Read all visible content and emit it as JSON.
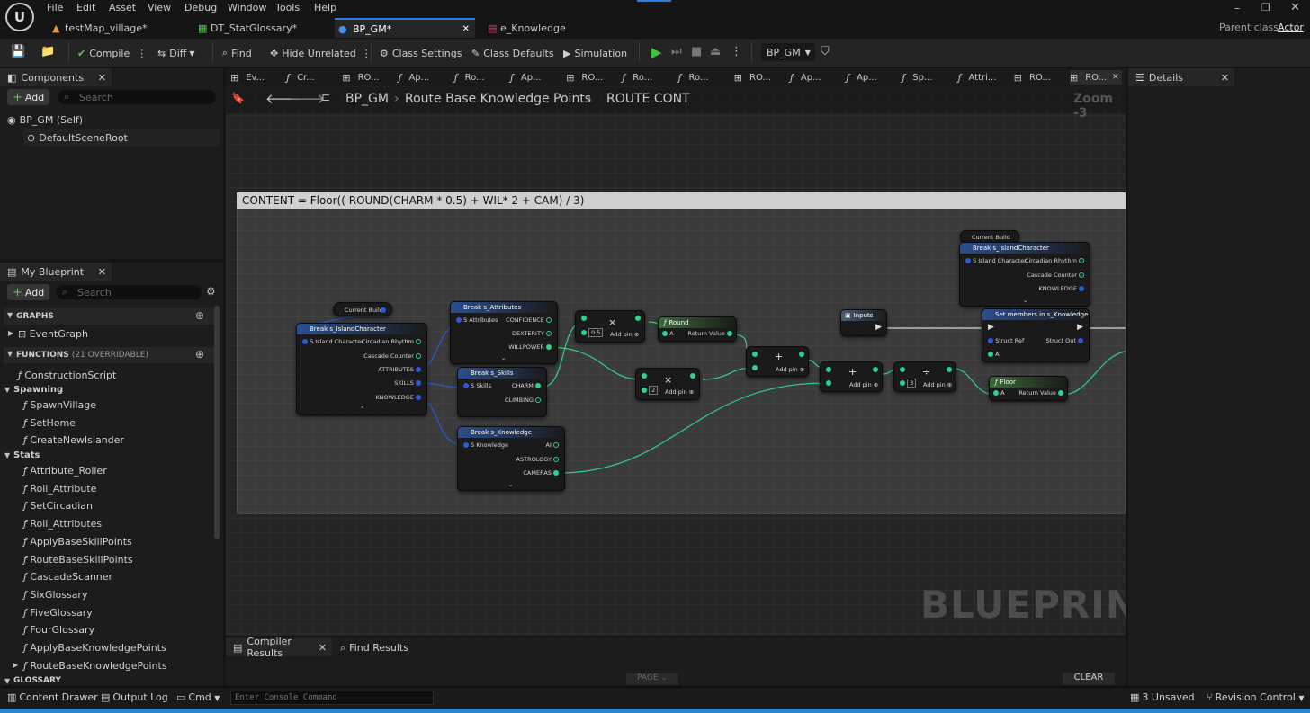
{
  "menu": {
    "file": "File",
    "edit": "Edit",
    "asset": "Asset",
    "view": "View",
    "debug": "Debug",
    "window": "Window",
    "tools": "Tools",
    "help": "Help"
  },
  "parent_class": {
    "label": "Parent class:",
    "value": "Actor"
  },
  "tabs": [
    {
      "label": "testMap_village*"
    },
    {
      "label": "DT_StatGlossary*"
    },
    {
      "label": "BP_GM*"
    },
    {
      "label": "e_Knowledge"
    }
  ],
  "toolbar": {
    "compile": "Compile",
    "diff": "Diff",
    "find": "Find",
    "hide_unrelated": "Hide Unrelated",
    "class_settings": "Class Settings",
    "class_defaults": "Class Defaults",
    "simulation": "Simulation",
    "debug_object": "BP_GM"
  },
  "components": {
    "title": "Components",
    "add": "Add",
    "search": "Search",
    "self": "BP_GM (Self)",
    "root": "DefaultSceneRoot"
  },
  "my_blueprint": {
    "title": "My Blueprint",
    "add": "Add",
    "search": "Search",
    "graphs": "GRAPHS",
    "event_graph": "EventGraph",
    "functions": "FUNCTIONS",
    "overridable": "(21 OVERRIDABLE)",
    "construction": "ConstructionScript",
    "spawning": "Spawning",
    "spawning_items": [
      "SpawnVillage",
      "SetHome",
      "CreateNewIslander"
    ],
    "stats": "Stats",
    "stats_items": [
      "Attribute_Roller",
      "Roll_Attribute",
      "SetCircadian",
      "Roll_Attributes",
      "ApplyBaseSkillPoints",
      "RouteBaseSkillPoints",
      "CascadeScanner",
      "SixGlossary",
      "FiveGlossary",
      "FourGlossary",
      "ApplyBaseKnowledgePoints",
      "RouteBaseKnowledgePoints"
    ],
    "glossary": "GLOSSARY"
  },
  "graph_tabs": [
    "Ev...",
    "Cr...",
    "RO...",
    "Ap...",
    "Ro...",
    "Ap...",
    "RO...",
    "Ro...",
    "Ro...",
    "RO...",
    "Ap...",
    "Ap...",
    "Sp...",
    "Attri...",
    "RO...",
    "RO..."
  ],
  "breadcrumb": {
    "root": "BP_GM",
    "mid": "Route Base Knowledge Points",
    "leaf": "ROUTE CONT"
  },
  "zoom": "Zoom -3",
  "comment": "CONTENT = Floor(( ROUND(CHARM * 0.5) + WIL* 2 + CAM) / 3)",
  "watermark": "BLUEPRINT",
  "details": {
    "title": "Details"
  },
  "nodes": {
    "current_build": "Current Build",
    "break_island": "Break s_IslandCharacter",
    "s_island_character": "S Island Character",
    "circadian_rhythm": "Circadian Rhythm",
    "cascade_counter": "Cascade Counter",
    "attributes": "ATTRIBUTES",
    "skills": "SKILLS",
    "knowledge": "KNOWLEDGE",
    "break_attributes": "Break s_Attributes",
    "s_attributes": "S Attributes",
    "confidence": "CONFIDENCE",
    "dexterity": "DEXTERITY",
    "willpower": "WILLPOWER",
    "break_skills": "Break s_Skills",
    "s_skills": "S Skills",
    "charm": "CHARM",
    "climbing": "CLIMBING",
    "break_knowledge": "Break s_Knowledge",
    "s_knowledge": "S Knowledge",
    "ai": "AI",
    "astrology": "ASTROLOGY",
    "cameras": "CAMERAS",
    "mul": "×",
    "add": "+",
    "div": "÷",
    "add_pin": "Add pin",
    "half": "0.5",
    "two": "2",
    "three": "3",
    "round": "Round",
    "floor": "Floor",
    "a": "A",
    "return_value": "Return Value",
    "inputs": "Inputs",
    "set_members": "Set members in s_Knowledge",
    "struct_ref": "Struct Ref",
    "struct_out": "Struct Out"
  },
  "bottom": {
    "compiler_results": "Compiler Results",
    "find_results": "Find Results",
    "page": "PAGE",
    "clear": "CLEAR",
    "content_drawer": "Content Drawer",
    "output_log": "Output Log",
    "cmd": "Cmd",
    "console_placeholder": "Enter Console Command",
    "unsaved": "3 Unsaved",
    "revision": "Revision Control"
  }
}
